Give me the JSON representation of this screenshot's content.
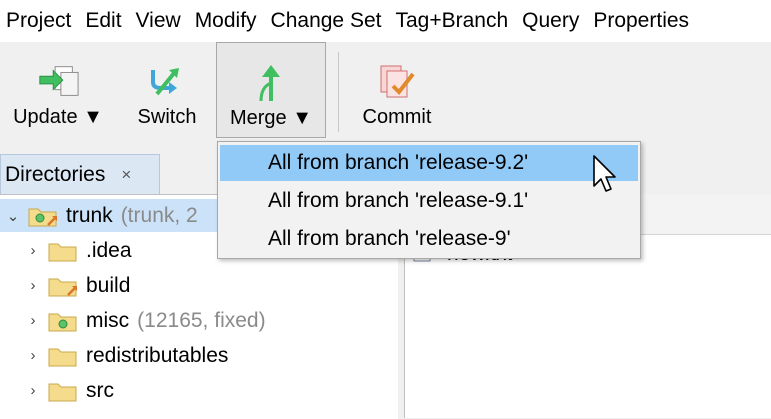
{
  "menubar": {
    "items": [
      "Project",
      "Edit",
      "View",
      "Modify",
      "Change Set",
      "Tag+Branch",
      "Query",
      "Properties"
    ]
  },
  "toolbar": {
    "update_label": "Update ▼",
    "switch_label": "Switch",
    "merge_label": "Merge ▼",
    "commit_label": "Commit"
  },
  "directories": {
    "tab_label": "Directories",
    "close_glyph": "×",
    "rows": [
      {
        "name": "trunk",
        "meta": "(trunk, 2",
        "expanded": true,
        "selected": true
      },
      {
        "name": ".idea",
        "meta": ""
      },
      {
        "name": "build",
        "meta": ""
      },
      {
        "name": "misc",
        "meta": "(12165, fixed)"
      },
      {
        "name": "redistributables",
        "meta": ""
      },
      {
        "name": "src",
        "meta": ""
      }
    ]
  },
  "file_panel": {
    "visible_file": "new.txt"
  },
  "merge_menu": {
    "items": [
      "All from branch 'release-9.2'",
      "All from branch 'release-9.1'",
      "All from branch 'release-9'"
    ],
    "hovered_index": 0
  },
  "colors": {
    "selection": "#cce2f8",
    "menu_hover": "#91c9f7",
    "tab_active": "#dce7f4"
  }
}
